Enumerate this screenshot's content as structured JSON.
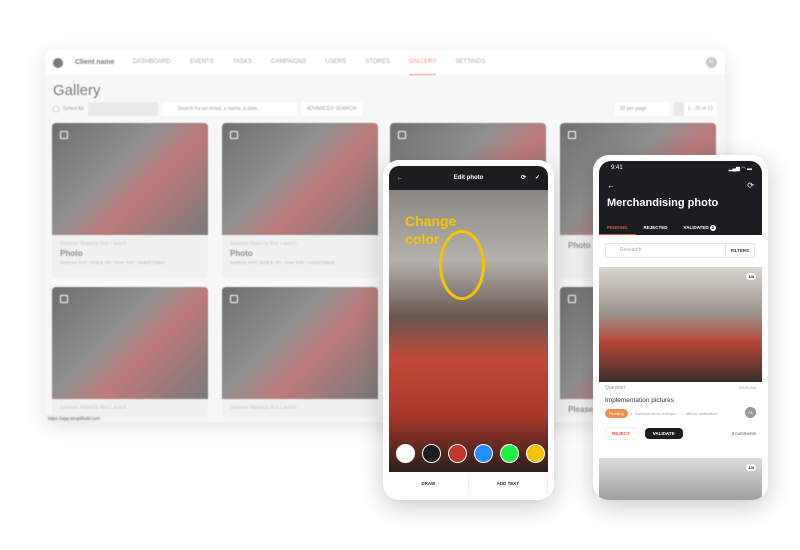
{
  "desktop": {
    "client": "Client name",
    "nav": [
      "DASHBOARD",
      "EVENTS",
      "TASKS",
      "CAMPAIGNS",
      "USERS",
      "STORES",
      "GALLERY",
      "SETTINGS"
    ],
    "active": "GALLERY",
    "avatar": "AL",
    "title": "Gallery",
    "select_all": "Select All",
    "search_placeholder": "Search for an email, a name, a date...",
    "advanced": "ADVANCED SEARCH",
    "per_page": "20 per page",
    "pagination": "1 - 20 of 21",
    "url": "https://app.simplifield.com",
    "cards": [
      {
        "sub": "Summer MakeUp Box Launch",
        "name": "Photo",
        "loc": "Sephora NYC 42nd & 7th - New York - United States"
      },
      {
        "sub": "Summer MakeUp Box Launch",
        "name": "Photo",
        "loc": "Sephora NYC 42nd & 7th - New York - United States"
      },
      {
        "sub": "",
        "name": "",
        "loc": ""
      },
      {
        "sub": "",
        "name": "Photo",
        "loc": ""
      },
      {
        "sub": "Summer MakeUp Box Launch",
        "name": "",
        "loc": ""
      },
      {
        "sub": "Summer MakeUp Box Launch",
        "name": "",
        "loc": ""
      },
      {
        "sub": "",
        "name": "",
        "loc": ""
      },
      {
        "sub": "",
        "name": "Please",
        "loc": ""
      }
    ]
  },
  "edit_phone": {
    "title": "Edit photo",
    "annotation": "Change color",
    "colors": [
      "#ffffff",
      "#1b1d20",
      "#c0392b",
      "#1e90ff",
      "#22ee44",
      "#f5c400"
    ],
    "draw": "DRAW",
    "add_text": "ADD TEXT"
  },
  "merch_phone": {
    "time": "9:41",
    "title": "Merchandising photo",
    "tabs": [
      "PENDING",
      "REJECTED",
      "VALIDATED"
    ],
    "validated_count": "2",
    "search_placeholder": "Research",
    "filters": "FILTERS",
    "count": "1/4",
    "question": "Question:",
    "qtime": "09:00 AM",
    "item": "Implementation pictures",
    "status": "Pending",
    "tag1": "Concept store champs...",
    "tag2": "Merch Verification",
    "avatar": "AL",
    "reject": "REJECT",
    "validate": "VALIDATE",
    "comments": "3 comments"
  }
}
